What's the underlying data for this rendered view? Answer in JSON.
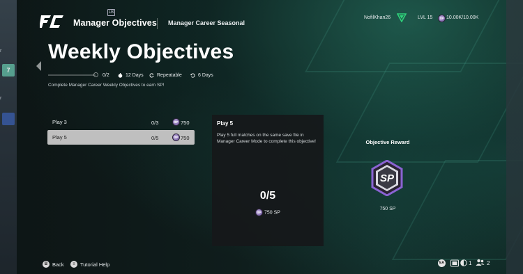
{
  "header": {
    "app_title": "Manager Objectives",
    "subtitle": "Manager Career Seasonal",
    "bumper_hint": "LB",
    "username": "NofilKhan26",
    "level": "LVL 15",
    "sp_balance": "10.00K/10.00K",
    "sp_icon_text": "SP"
  },
  "page": {
    "title": "Weekly Objectives",
    "progress_text": "0/2",
    "progress_fraction": 0,
    "duration": "12 Days",
    "repeat_label": "Repeatable",
    "repeat_interval": "6 Days",
    "description": "Complete Manager Career Weekly Objectives to earn SP!"
  },
  "objectives": [
    {
      "name": "Play 3",
      "progress": "0/3",
      "reward": "750"
    },
    {
      "name": "Play 5",
      "progress": "0/5",
      "reward": "750"
    }
  ],
  "detail": {
    "title": "Play 5",
    "description": "Play 5 full matches on the same save file in Manager Career Mode to complete this objective!",
    "progress": "0/5",
    "reward": "750 SP"
  },
  "reward_panel": {
    "label": "Objective Reward",
    "badge_text": "SP",
    "value": "750 SP"
  },
  "left_peek": {
    "top_text": "areer",
    "bottom_text": "areer",
    "card_number": "7"
  },
  "footer": {
    "back_key": "B",
    "back_label": "Back",
    "help_key": "≡",
    "help_label": "Tutorial Help",
    "ea_text": "EA",
    "count_one": "1",
    "friends_count": "2"
  },
  "colors": {
    "accent_green": "#2fd17a",
    "sp_purple": "#7a5fb0",
    "selected_row": "#bfbfbf"
  }
}
